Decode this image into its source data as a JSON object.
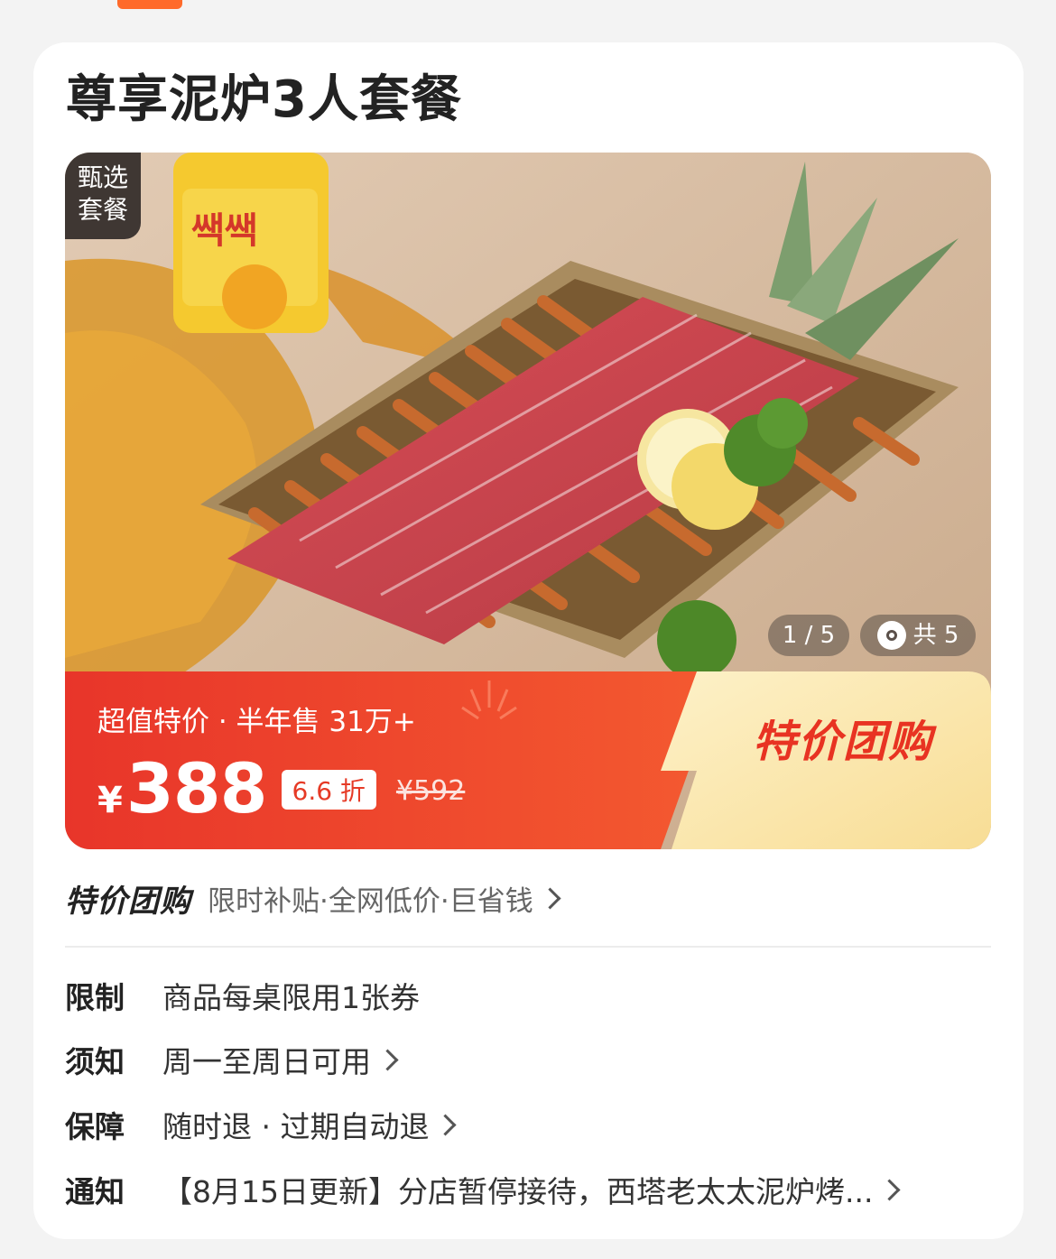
{
  "title": "尊享泥炉3人套餐",
  "hero": {
    "badge_line1": "甄选",
    "badge_line2": "套餐",
    "counter": "1 / 5",
    "photo_count": "共 5",
    "promo_sub": "超值特价 · 半年售 31万+",
    "currency": "¥",
    "price": "388",
    "discount": "6.6 折",
    "original_price": "¥592",
    "promo_tag": "特价团购",
    "colors": {
      "promo_red": "#e8352a",
      "promo_yellow": "#fbe6b0"
    }
  },
  "promo_line": {
    "brand": "特价团购",
    "desc": "限时补贴·全网低价·巨省钱"
  },
  "info": [
    {
      "label": "限制",
      "value": "商品每桌限用1张券",
      "chevron": false
    },
    {
      "label": "须知",
      "value": "周一至周日可用",
      "chevron": true
    },
    {
      "label": "保障",
      "value": "随时退 · 过期自动退",
      "chevron": true
    },
    {
      "label": "通知",
      "value": "【8月15日更新】分店暂停接待，西塔老太太泥炉烤...",
      "chevron": true
    }
  ]
}
